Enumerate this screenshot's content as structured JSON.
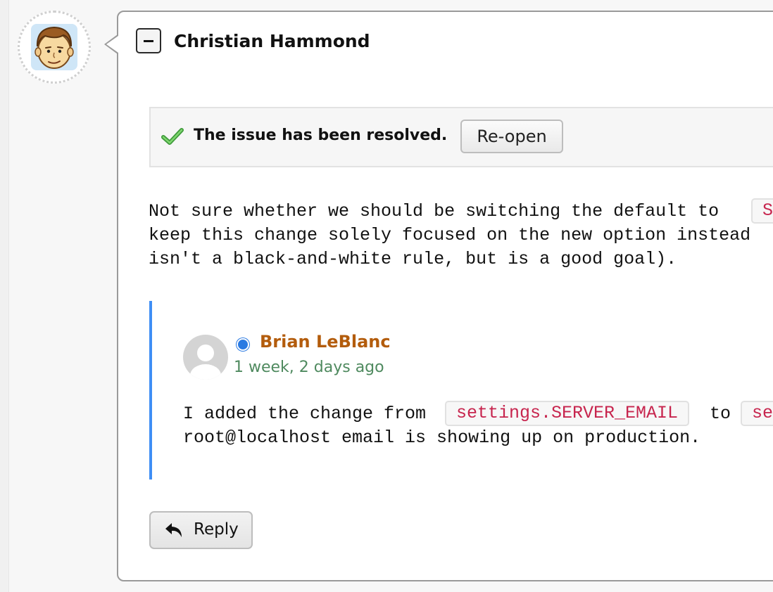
{
  "review": {
    "author_name": "Christian Hammond",
    "author_avatar_icon": "cartoon-face-avatar",
    "collapse_icon": "minus-icon"
  },
  "issue": {
    "status_text": "The issue has been resolved.",
    "status_icon": "check-icon",
    "reopen_label": "Re-open"
  },
  "comment": {
    "line1_text": "Not sure whether we should be switching the default to ",
    "line1_code": "S",
    "line2": "keep this change solely focused on the new option instead",
    "line3": "isn't a black-and-white rule, but is a good goal)."
  },
  "quoted": {
    "author": "Brian LeBlanc",
    "time": "1 week, 2 days ago",
    "online_color": "#2a7ae2",
    "line1_prefix": "I added the change from ",
    "code1": "settings.SERVER_EMAIL",
    "line1_mid": " to ",
    "code2": "se",
    "line2": "root@localhost email is showing up on production."
  },
  "actions": {
    "reply_label": "Reply",
    "reply_icon": "reply-arrow-icon"
  },
  "colors": {
    "code_text": "#c7254e",
    "quote_bar": "#3f8ef5",
    "author_link": "#b35c0c",
    "timestamp": "#4f8a5f"
  }
}
